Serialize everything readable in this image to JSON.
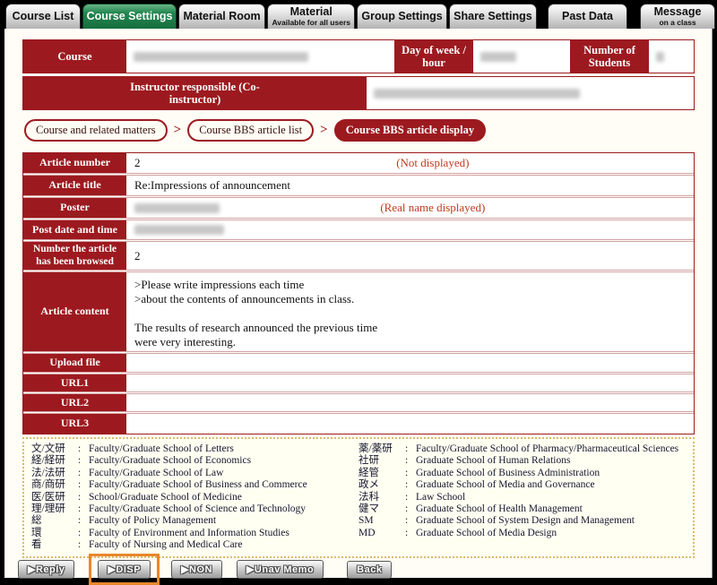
{
  "colors": {
    "maroon": "#9c1a1f",
    "tab_green": "#1d7c47",
    "annotation_red": "#c23b22",
    "legend_border": "#dcb96f",
    "highlight_orange": "#e8872b"
  },
  "tabs": [
    {
      "label": "Course List",
      "sublabel": "",
      "active": false
    },
    {
      "label": "Course Settings",
      "sublabel": "",
      "active": true
    },
    {
      "label": "Material Room",
      "sublabel": "",
      "active": false
    },
    {
      "label": "Material",
      "sublabel": "Available for all users",
      "active": false
    },
    {
      "label": "Group Settings",
      "sublabel": "",
      "active": false
    },
    {
      "label": "Share Settings",
      "sublabel": "",
      "active": false
    },
    {
      "label": "Past Data",
      "sublabel": "",
      "active": false
    },
    {
      "label": "Message",
      "sublabel": "on a class",
      "active": false
    }
  ],
  "course_info": {
    "course_label": "Course",
    "day_label": "Day of week / hour",
    "students_label": "Number of Students",
    "instructor_label": "Instructor responsible (Co-instructor)"
  },
  "breadcrumb": {
    "separator": ">",
    "items": [
      {
        "label": "Course and related matters",
        "active": false
      },
      {
        "label": "Course BBS article list",
        "active": false
      },
      {
        "label": "Course BBS article display",
        "active": true
      }
    ]
  },
  "article": {
    "rows": [
      {
        "label": "Article number",
        "value": "2",
        "annotation": "(Not displayed)",
        "redacted": false
      },
      {
        "label": "Article title",
        "value": "Re:Impressions of announcement",
        "annotation": "",
        "redacted": false
      },
      {
        "label": "Poster",
        "value": "",
        "annotation": "(Real name displayed)",
        "redacted": true
      },
      {
        "label": "Post date and time",
        "value": "",
        "annotation": "",
        "redacted": true
      },
      {
        "label": "Number the article has been browsed",
        "value": "2",
        "annotation": "",
        "redacted": false
      },
      {
        "label": "Article content",
        "value": ">Please write impressions each time\n>about the contents of announcements in class.\n\nThe results of research announced the previous time\nwere very interesting.",
        "annotation": "",
        "redacted": false
      },
      {
        "label": "Upload file",
        "value": "",
        "annotation": "",
        "redacted": false
      },
      {
        "label": "URL1",
        "value": "",
        "annotation": "",
        "redacted": false
      },
      {
        "label": "URL2",
        "value": "",
        "annotation": "",
        "redacted": false
      },
      {
        "label": "URL3",
        "value": "",
        "annotation": "",
        "redacted": false
      }
    ]
  },
  "legend": {
    "separator": ":",
    "left": [
      {
        "abbr": "文/文研",
        "desc": "Faculty/Graduate School of Letters"
      },
      {
        "abbr": "経/経研",
        "desc": "Faculty/Graduate School of Economics"
      },
      {
        "abbr": "法/法研",
        "desc": "Faculty/Graduate School of Law"
      },
      {
        "abbr": "商/商研",
        "desc": "Faculty/Graduate School of Business and Commerce"
      },
      {
        "abbr": "医/医研",
        "desc": "School/Graduate School of Medicine"
      },
      {
        "abbr": "理/理研",
        "desc": "Faculty/Graduate School of Science and Technology"
      },
      {
        "abbr": "総",
        "desc": "Faculty of Policy Management"
      },
      {
        "abbr": "環",
        "desc": "Faculty of Environment and Information Studies"
      },
      {
        "abbr": "看",
        "desc": "Faculty of Nursing and Medical Care"
      }
    ],
    "right": [
      {
        "abbr": "薬/薬研",
        "desc": "Faculty/Graduate School of Pharmacy/Pharmaceutical Sciences"
      },
      {
        "abbr": "社研",
        "desc": "Graduate School of Human Relations"
      },
      {
        "abbr": "経管",
        "desc": "Graduate School of Business Administration"
      },
      {
        "abbr": "政メ",
        "desc": "Graduate School of Media and Governance"
      },
      {
        "abbr": "法科",
        "desc": "Law School"
      },
      {
        "abbr": "健マ",
        "desc": "Graduate School of Health Management"
      },
      {
        "abbr": "SM",
        "desc": "Graduate School of System Design and Management"
      },
      {
        "abbr": "MD",
        "desc": "Graduate School of Media Design"
      }
    ]
  },
  "buttons": [
    {
      "label": "▶Reply",
      "highlighted": false
    },
    {
      "label": "▶DISP",
      "highlighted": true
    },
    {
      "label": "▶NON",
      "highlighted": false
    },
    {
      "label": "▶Unav Memo",
      "highlighted": false
    },
    {
      "label": "Back",
      "highlighted": false
    }
  ]
}
